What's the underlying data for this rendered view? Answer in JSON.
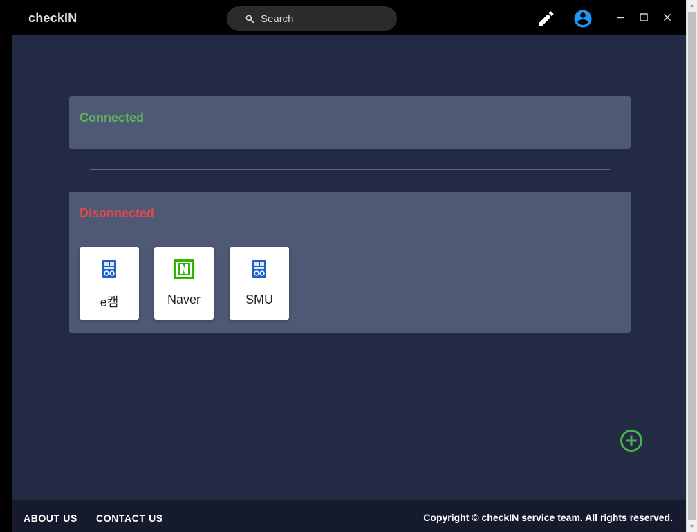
{
  "app": {
    "title": "checkIN"
  },
  "search": {
    "placeholder": "Search"
  },
  "colors": {
    "connected": "#5cb85c",
    "disconnected": "#e04a4a",
    "add_button": "#4caf50",
    "account_icon": "#2196f3",
    "naver_green": "#2db400",
    "university_blue": "#1e5fc7"
  },
  "icons": {
    "edit": "pencil-icon",
    "account": "account-circle-icon",
    "add": "add-circle-icon"
  },
  "sections": {
    "connected": {
      "title": "Connected",
      "items": []
    },
    "disconnected": {
      "title": "Disonnected",
      "items": [
        {
          "label": "e캠",
          "icon": "university-logo-icon"
        },
        {
          "label": "Naver",
          "icon": "naver-logo-icon"
        },
        {
          "label": "SMU",
          "icon": "university-logo-icon"
        }
      ]
    }
  },
  "footer": {
    "about": "ABOUT US",
    "contact": "CONTACT US",
    "copyright": "Copyright © checkIN service team. All rights reserved."
  }
}
